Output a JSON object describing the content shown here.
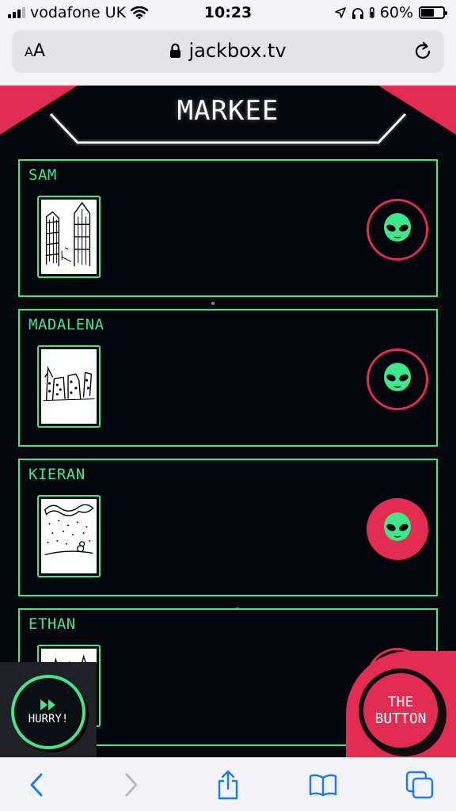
{
  "status": {
    "carrier": "vodafone UK",
    "time": "10:23",
    "battery": "60%",
    "battery_level": 0.6
  },
  "browser": {
    "text_size_button": "AA",
    "url": "jackbox.tv"
  },
  "game": {
    "title": "MARKEE",
    "cards": [
      {
        "player": "SAM",
        "vote_icon": "alien-icon",
        "voted": false
      },
      {
        "player": "MADALENA",
        "vote_icon": "alien-icon",
        "voted": false
      },
      {
        "player": "KIERAN",
        "vote_icon": "alien-icon",
        "voted": true
      },
      {
        "player": "ETHAN",
        "vote_icon": "alien-icon",
        "voted": false
      }
    ],
    "hurry_label": "HURRY!",
    "the_button_line1": "THE",
    "the_button_line2": "BUTTON"
  },
  "colors": {
    "accent_green": "#3ee88a",
    "accent_red": "#e22c52",
    "background": "#05070d"
  }
}
